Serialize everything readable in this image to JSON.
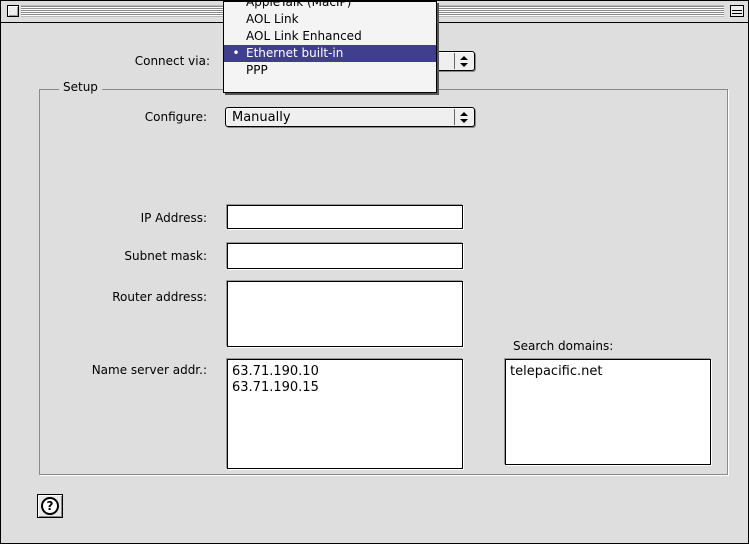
{
  "window": {
    "title": ""
  },
  "connect_via": {
    "label": "Connect via:",
    "selected": "Ethernet built-in",
    "menu_items": [
      "AppleTalk (MacIP)",
      "AOL Link",
      "AOL Link Enhanced",
      "Ethernet built-in",
      "PPP"
    ],
    "check_glyph": "•"
  },
  "setup": {
    "title": "Setup",
    "configure": {
      "label": "Configure:",
      "value": "Manually"
    },
    "ip_address": {
      "label": "IP Address:",
      "value": ""
    },
    "subnet_mask": {
      "label": "Subnet mask:",
      "value": ""
    },
    "router_address": {
      "label": "Router address:",
      "value": ""
    },
    "name_server": {
      "label": "Name server addr.:",
      "lines": [
        "63.71.190.10",
        "63.71.190.15"
      ]
    },
    "search_domains": {
      "label": "Search domains:",
      "lines": [
        "telepacific.net"
      ]
    }
  },
  "help": {
    "icon": "help-icon",
    "glyph": "?"
  },
  "colors": {
    "window_bg": "#dedede",
    "menu_highlight": "#3f3f8e"
  }
}
